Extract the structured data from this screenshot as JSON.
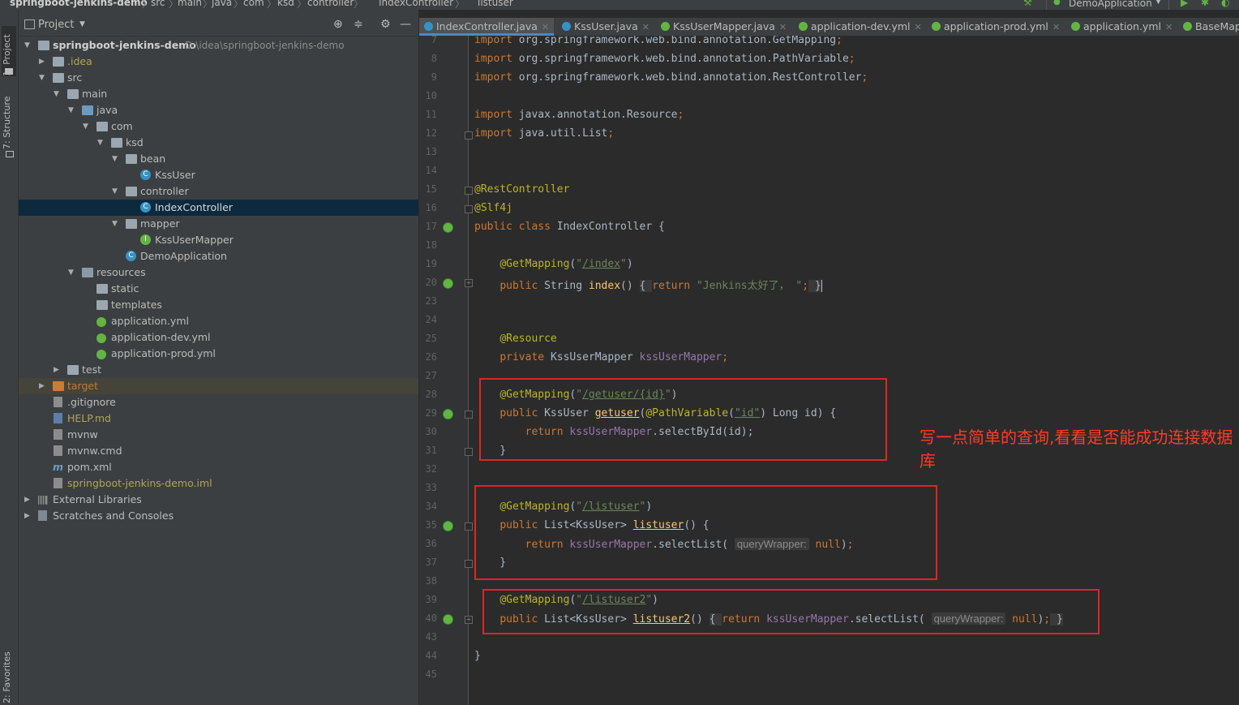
{
  "breadcrumb": [
    "springboot-jenkins-demo",
    "src",
    "main",
    "java",
    "com",
    "ksd",
    "controller",
    "IndexController",
    "listuser"
  ],
  "run_config": "DemoApplication",
  "left_strip": {
    "project_tab": "1: Project",
    "structure_tab": "7: Structure",
    "favorites_tab": "2: Favorites"
  },
  "project_panel": {
    "title": "Project"
  },
  "tree": [
    {
      "label": "springboot-jenkins-demo",
      "path": "D:\\idea\\springboot-jenkins-demo"
    },
    {
      "label": ".idea"
    },
    {
      "label": "src"
    },
    {
      "label": "main"
    },
    {
      "label": "java"
    },
    {
      "label": "com"
    },
    {
      "label": "ksd"
    },
    {
      "label": "bean"
    },
    {
      "label": "KssUser"
    },
    {
      "label": "controller"
    },
    {
      "label": "IndexController"
    },
    {
      "label": "mapper"
    },
    {
      "label": "KssUserMapper"
    },
    {
      "label": "DemoApplication"
    },
    {
      "label": "resources"
    },
    {
      "label": "static"
    },
    {
      "label": "templates"
    },
    {
      "label": "application.yml"
    },
    {
      "label": "application-dev.yml"
    },
    {
      "label": "application-prod.yml"
    },
    {
      "label": "test"
    },
    {
      "label": "target"
    },
    {
      "label": ".gitignore"
    },
    {
      "label": "HELP.md"
    },
    {
      "label": "mvnw"
    },
    {
      "label": "mvnw.cmd"
    },
    {
      "label": "pom.xml"
    },
    {
      "label": "springboot-jenkins-demo.iml"
    },
    {
      "label": "External Libraries"
    },
    {
      "label": "Scratches and Consoles"
    }
  ],
  "tabs": [
    "IndexController.java",
    "KssUser.java",
    "KssUserMapper.java",
    "application-dev.yml",
    "application-prod.yml",
    "application.yml",
    "BaseMap"
  ],
  "line_numbers": [
    "7",
    "8",
    "9",
    "10",
    "11",
    "12",
    "13",
    "14",
    "15",
    "16",
    "17",
    "18",
    "19",
    "20",
    "23",
    "24",
    "25",
    "26",
    "27",
    "28",
    "29",
    "30",
    "31",
    "32",
    "33",
    "34",
    "35",
    "36",
    "37",
    "38",
    "39",
    "40",
    "43",
    "44",
    "45"
  ],
  "code": {
    "l7": "org.springframework.web.bind.annotation.GetMapping",
    "l8": "org.springframework.web.bind.annotation.PathVariable",
    "l9": "org.springframework.web.bind.annotation.RestController",
    "l11": "javax.annotation.Resource",
    "l12": "java.util.List",
    "l15": "@RestController",
    "l16": "@Slf4j",
    "l17_class": "IndexController",
    "l19_path": "/index",
    "l20_method": "index",
    "l20_string": "\"Jenkins太好了， \"",
    "l25": "@Resource",
    "l26_type": "KssUserMapper",
    "l26_field": "kssUserMapper",
    "l28_path": "/getuser/{id}",
    "l29_method": "getuser",
    "l29_param": "\"id\"",
    "l30_call": ".selectById(id);",
    "l34_path": "/listuser",
    "l35_method": "listuser",
    "l36_call": ".selectList(",
    "hint": "queryWrapper:",
    "l39_path": "/listuser2",
    "l40_method": "listuser2"
  },
  "annotation_text": "写一点简单的查询,看看是否能成功连接数据库"
}
